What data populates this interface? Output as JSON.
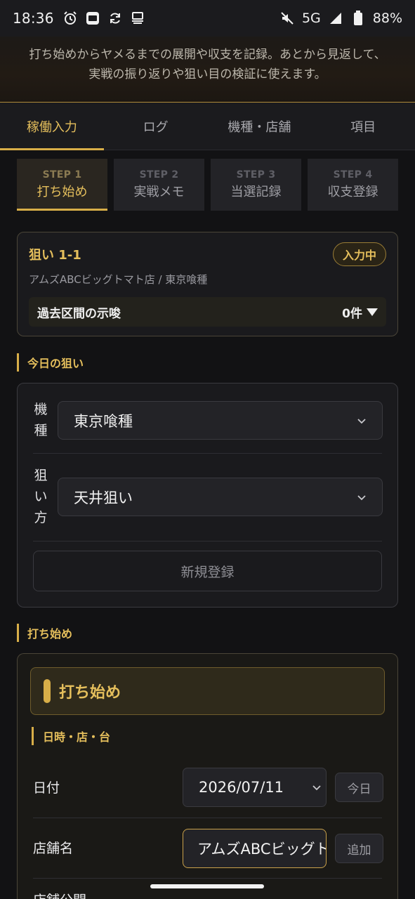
{
  "status_bar": {
    "time": "18:36",
    "network": "5G",
    "battery": "88%",
    "icons": [
      "alarm-icon",
      "app-icon",
      "sync-icon",
      "cast-icon",
      "mute-icon",
      "signal-icon",
      "battery-icon"
    ]
  },
  "intro": {
    "line1": "打ち始めからヤメるまでの展開や収支を記録。あとから見返して、",
    "line2": "実戦の振り返りや狙い目の検証に使えます。"
  },
  "tabs": [
    {
      "label": "稼働入力",
      "active": true
    },
    {
      "label": "ログ",
      "active": false
    },
    {
      "label": "機種・店舗",
      "active": false
    },
    {
      "label": "項目",
      "active": false
    }
  ],
  "steps": [
    {
      "num": "STEP 1",
      "name": "打ち始め",
      "active": true
    },
    {
      "num": "STEP 2",
      "name": "実戦メモ",
      "active": false
    },
    {
      "num": "STEP 3",
      "name": "当選記録",
      "active": false
    },
    {
      "num": "STEP 4",
      "name": "収支登録",
      "active": false
    }
  ],
  "target_card": {
    "title": "狙い 1-1",
    "badge": "入力中",
    "subtitle": "アムズABCビッグトマト店 / 東京喰種",
    "past_label": "過去区間の示唆",
    "past_count": "0件"
  },
  "today_section": {
    "heading": "今日の狙い",
    "machine_label": [
      "機",
      "種"
    ],
    "machine_value": "東京喰種",
    "method_label": [
      "狙",
      "い",
      "方"
    ],
    "method_value": "天井狙い",
    "new_button": "新規登録"
  },
  "start_section": {
    "heading": "打ち始め",
    "banner_title": "打ち始め",
    "subheading": "日時・店・台",
    "date_label": "日付",
    "date_value": "2026/07/11",
    "today_button": "今日",
    "store_label": "店舗名",
    "store_value": "アムズABCビッグトマト店",
    "add_button": "追加",
    "next_label": "店舗公開"
  },
  "colors": {
    "accent": "#e5bf5c",
    "background": "#121214",
    "card": "#1a1a1d"
  }
}
